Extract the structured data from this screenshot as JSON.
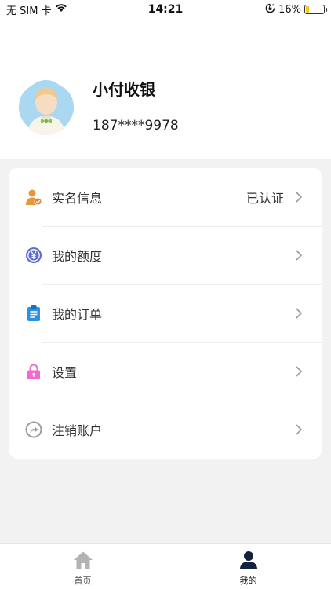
{
  "status_bar": {
    "carrier": "无 SIM 卡",
    "time": "14:21",
    "battery": "16%",
    "battery_level": 0.16
  },
  "profile": {
    "name": "小付收银",
    "phone": "187****9978"
  },
  "menu": {
    "items": [
      {
        "label": "实名信息",
        "value": "已认证",
        "icon": "verified-user-icon",
        "color": "#e8963a"
      },
      {
        "label": "我的额度",
        "value": "",
        "icon": "yuan-coin-icon",
        "color": "#5b6fc9"
      },
      {
        "label": "我的订单",
        "value": "",
        "icon": "clipboard-icon",
        "color": "#2a90e8"
      },
      {
        "label": "设置",
        "value": "",
        "icon": "lock-icon",
        "color": "#f06bd0"
      },
      {
        "label": "注销账户",
        "value": "",
        "icon": "share-arrow-icon",
        "color": "#9c9c9c"
      }
    ]
  },
  "tab_bar": {
    "tabs": [
      {
        "label": "首页",
        "icon": "home-icon",
        "active": false
      },
      {
        "label": "我的",
        "icon": "user-icon",
        "active": true
      }
    ]
  }
}
